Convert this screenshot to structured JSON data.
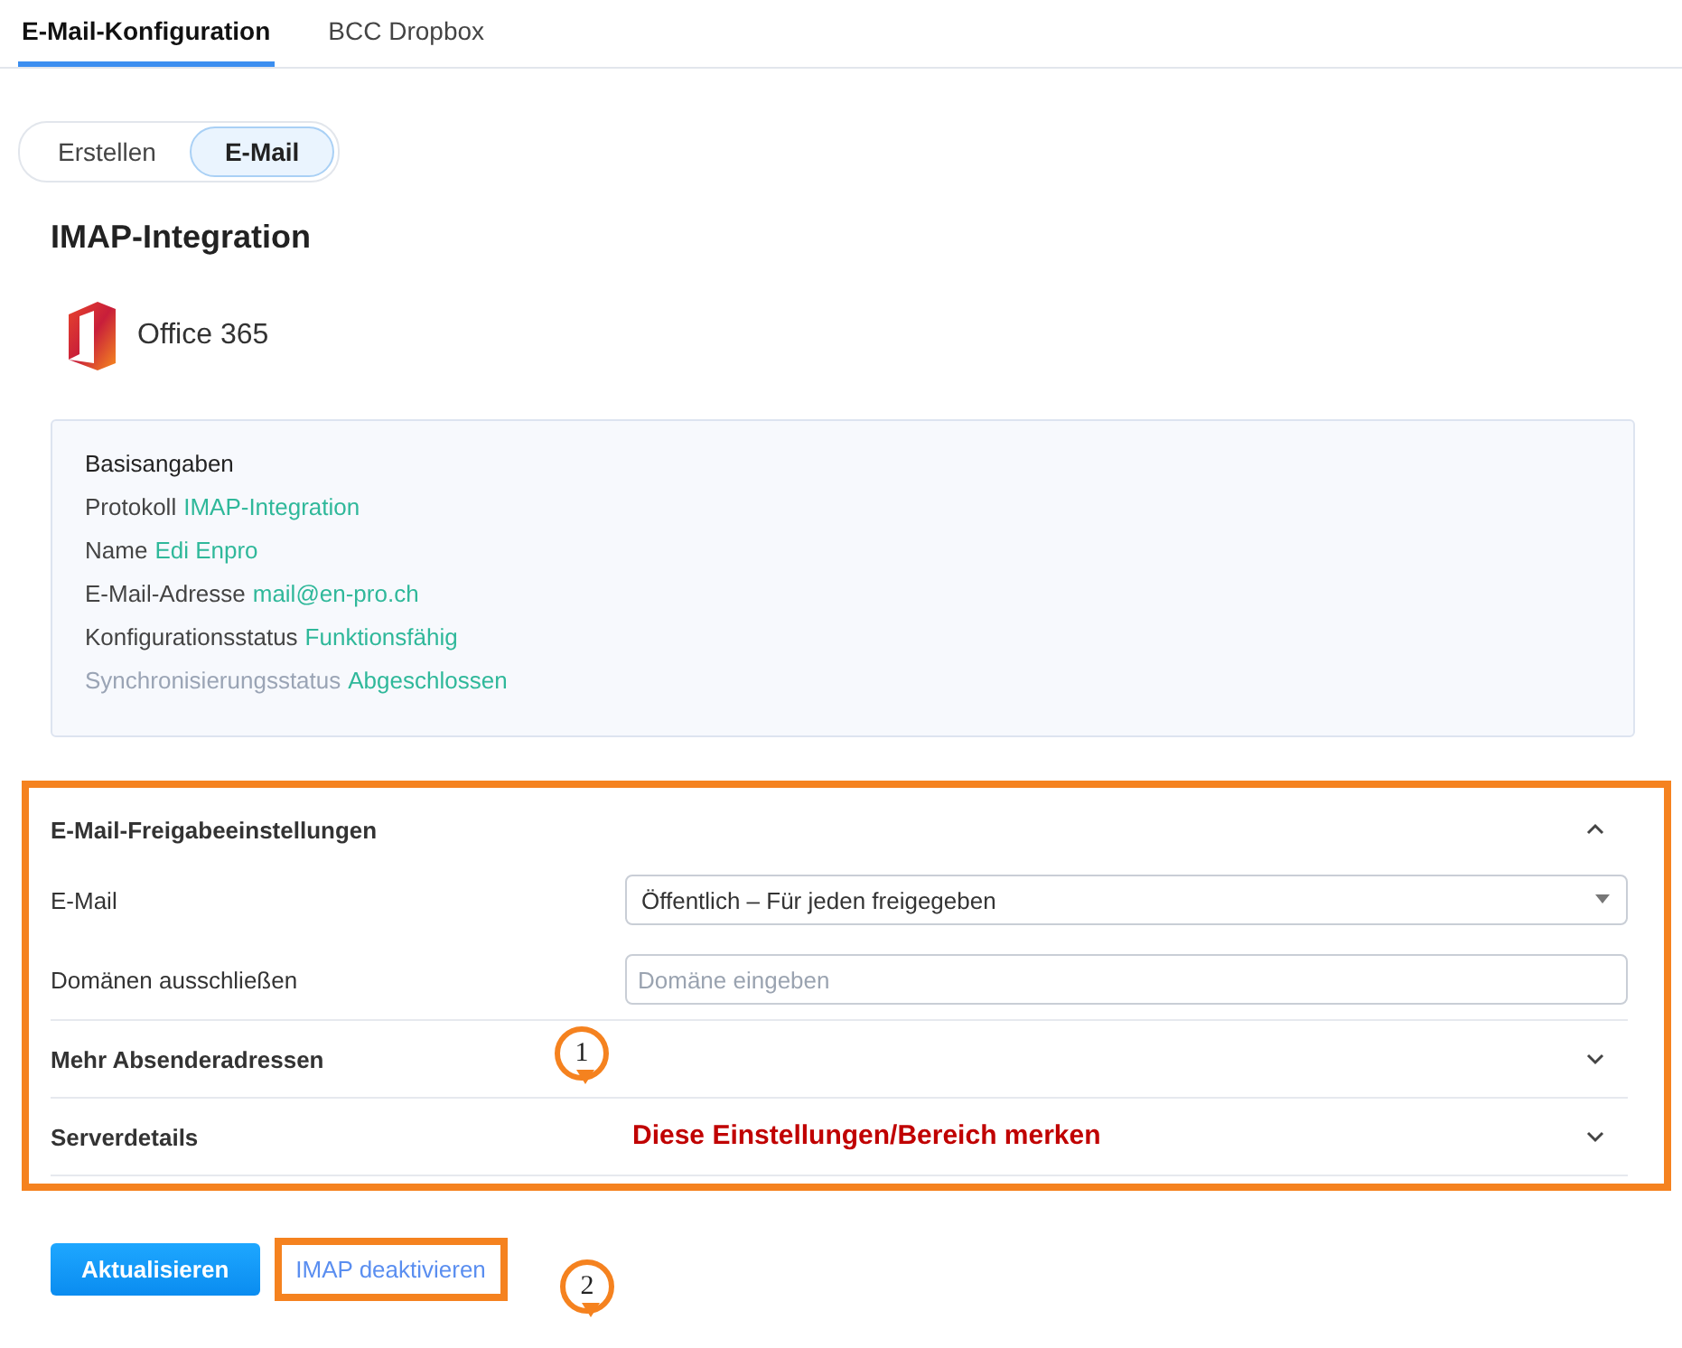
{
  "tabs": [
    {
      "label": "E-Mail-Konfiguration",
      "selected": true
    },
    {
      "label": "BCC Dropbox",
      "selected": false
    }
  ],
  "segments": [
    {
      "label": "Erstellen",
      "selected": false
    },
    {
      "label": "E-Mail",
      "selected": true
    }
  ],
  "title": "IMAP-Integration",
  "provider": "Office 365",
  "info": {
    "heading": "Basisangaben",
    "rows": [
      {
        "label": "Protokoll",
        "value": "IMAP-Integration",
        "dimmed": false
      },
      {
        "label": "Name",
        "value": "Edi Enpro",
        "dimmed": false
      },
      {
        "label": "E-Mail-Adresse",
        "value": "mail@en-pro.ch",
        "dimmed": false
      },
      {
        "label": "Konfigurationsstatus",
        "value": "Funktionsfähig",
        "dimmed": false
      },
      {
        "label": "Synchronisierungsstatus",
        "value": "Abgeschlossen",
        "dimmed": true
      }
    ]
  },
  "sections": [
    {
      "title": "E-Mail-Freigabeeinstellungen",
      "expanded": true,
      "fields": [
        {
          "kind": "select",
          "label": "E-Mail",
          "value": "Öffentlich – Für jeden freigegeben"
        },
        {
          "kind": "input",
          "label": "Domänen ausschließen",
          "placeholder": "Domäne eingeben"
        }
      ]
    },
    {
      "title": "Mehr Absenderadressen",
      "expanded": false
    },
    {
      "title": "Serverdetails",
      "expanded": false
    }
  ],
  "annotation_note": "Diese Einstellungen/Bereich merken",
  "markers": [
    "1",
    "2"
  ],
  "buttons": {
    "primary": "Aktualisieren",
    "link": "IMAP deaktivieren"
  }
}
